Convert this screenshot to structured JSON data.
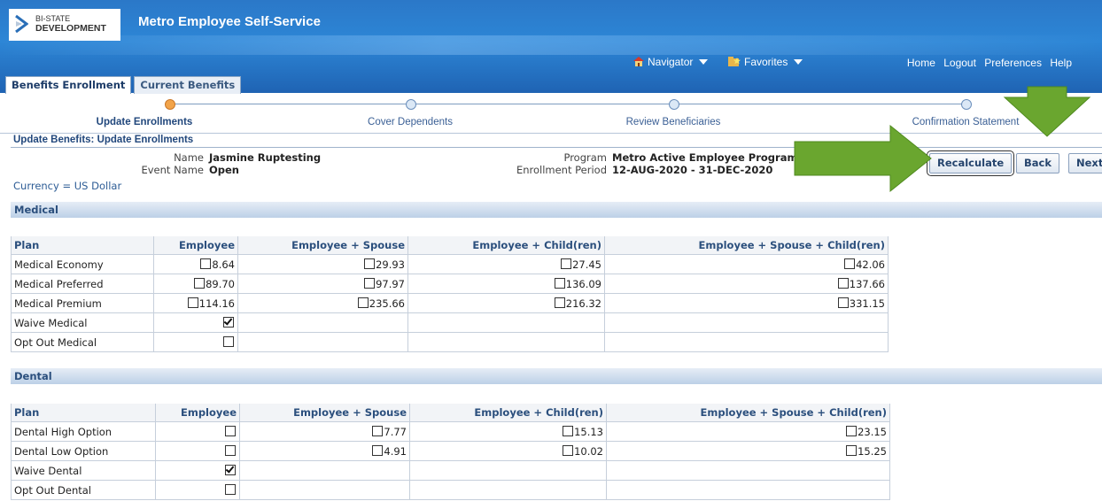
{
  "header": {
    "logo_line1": "BI-STATE",
    "logo_line2": "DEVELOPMENT",
    "app_title": "Metro Employee Self-Service",
    "navigator": "Navigator",
    "favorites": "Favorites",
    "links": [
      "Home",
      "Logout",
      "Preferences",
      "Help"
    ]
  },
  "tabs": [
    {
      "label": "Benefits Enrollment",
      "active": true
    },
    {
      "label": "Current Benefits",
      "active": false
    }
  ],
  "train": [
    {
      "label": "Update Enrollments",
      "current": true
    },
    {
      "label": "Cover Dependents",
      "current": false
    },
    {
      "label": "Review Beneficiaries",
      "current": false
    },
    {
      "label": "Confirmation Statement",
      "current": false
    }
  ],
  "page_title": "Update Benefits: Update Enrollments",
  "info": {
    "name_label": "Name",
    "name_value": "Jasmine Ruptesting",
    "event_label": "Event Name",
    "event_value": "Open",
    "program_label": "Program",
    "program_value": "Metro Active Employee Program",
    "period_label": "Enrollment Period",
    "period_value": "12-AUG-2020 - 31-DEC-2020",
    "currency": "Currency = US Dollar"
  },
  "buttons": {
    "recalculate": "Recalculate",
    "back": "Back",
    "next": "Next"
  },
  "columns": [
    "Plan",
    "Employee",
    "Employee + Spouse",
    "Employee + Child(ren)",
    "Employee + Spouse + Child(ren)"
  ],
  "medical": {
    "title": "Medical",
    "rows": [
      {
        "plan": "Medical Economy",
        "cells": [
          {
            "v": "8.64",
            "c": false
          },
          {
            "v": "29.93",
            "c": false
          },
          {
            "v": "27.45",
            "c": false
          },
          {
            "v": "42.06",
            "c": false
          }
        ]
      },
      {
        "plan": "Medical Preferred",
        "cells": [
          {
            "v": "89.70",
            "c": false
          },
          {
            "v": "97.97",
            "c": false
          },
          {
            "v": "136.09",
            "c": false
          },
          {
            "v": "137.66",
            "c": false
          }
        ]
      },
      {
        "plan": "Medical Premium",
        "cells": [
          {
            "v": "114.16",
            "c": false
          },
          {
            "v": "235.66",
            "c": false
          },
          {
            "v": "216.32",
            "c": false
          },
          {
            "v": "331.15",
            "c": false
          }
        ]
      },
      {
        "plan": "Waive Medical",
        "cells": [
          {
            "v": "",
            "c": true
          },
          null,
          null,
          null
        ]
      },
      {
        "plan": "Opt Out Medical",
        "cells": [
          {
            "v": "",
            "c": false
          },
          null,
          null,
          null
        ]
      }
    ]
  },
  "dental": {
    "title": "Dental",
    "rows": [
      {
        "plan": "Dental High Option",
        "cells": [
          {
            "v": "",
            "c": false
          },
          {
            "v": "7.77",
            "c": false
          },
          {
            "v": "15.13",
            "c": false
          },
          {
            "v": "23.15",
            "c": false
          }
        ]
      },
      {
        "plan": "Dental Low Option",
        "cells": [
          {
            "v": "",
            "c": false
          },
          {
            "v": "4.91",
            "c": false
          },
          {
            "v": "10.02",
            "c": false
          },
          {
            "v": "15.25",
            "c": false
          }
        ]
      },
      {
        "plan": "Waive Dental",
        "cells": [
          {
            "v": "",
            "c": true
          },
          null,
          null,
          null
        ]
      },
      {
        "plan": "Opt Out Dental",
        "cells": [
          {
            "v": "",
            "c": false
          },
          null,
          null,
          null
        ]
      }
    ]
  },
  "colors": {
    "header_blue": "#2d86d6",
    "arrow_green": "#6aa62f",
    "current_step": "#f2a44a"
  }
}
